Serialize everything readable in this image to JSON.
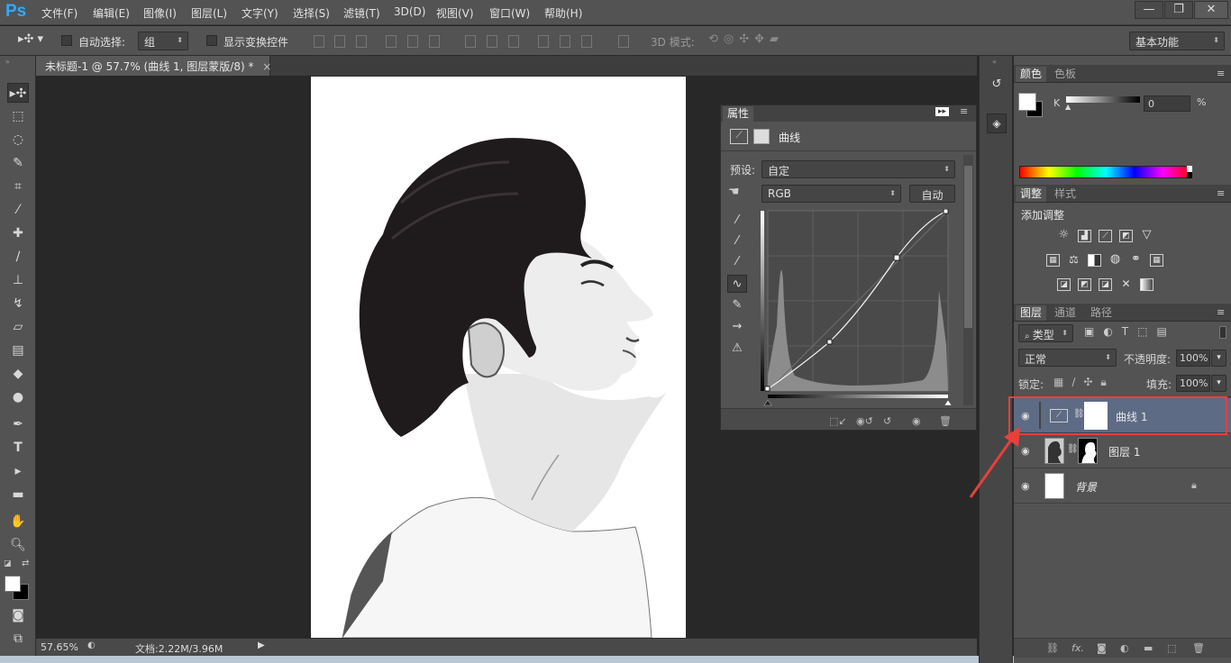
{
  "app": {
    "logo": "Ps"
  },
  "menu": [
    "文件(F)",
    "编辑(E)",
    "图像(I)",
    "图层(L)",
    "文字(Y)",
    "选择(S)",
    "滤镜(T)",
    "3D(D)",
    "视图(V)",
    "窗口(W)",
    "帮助(H)"
  ],
  "window_controls": {
    "minimize": "—",
    "restore": "❐",
    "close": "✕"
  },
  "options": {
    "auto_select_label": "自动选择:",
    "auto_select_value": "组",
    "show_transform_label": "显示变换控件",
    "mode_3d_label": "3D 模式:",
    "workspace": "基本功能"
  },
  "document_tab": {
    "title": "未标题-1 @ 57.7% (曲线 1, 图层蒙版/8) *",
    "close": "×"
  },
  "status": {
    "zoom": "57.65%",
    "doc_info": "文档:2.22M/3.96M"
  },
  "properties": {
    "tab": "属性",
    "title": "曲线",
    "preset_label": "预设:",
    "preset_value": "自定",
    "channel_value": "RGB",
    "auto_button": "自动"
  },
  "color_panel": {
    "tab_color": "颜色",
    "tab_swatches": "色板",
    "channel_label": "K",
    "value": "0",
    "unit": "%"
  },
  "adjustments_panel": {
    "tab_adjust": "调整",
    "tab_styles": "样式",
    "heading": "添加调整"
  },
  "layers_panel": {
    "tab_layers": "图层",
    "tab_channels": "通道",
    "tab_paths": "路径",
    "filter_kind": "类型",
    "blend_mode": "正常",
    "opacity_label": "不透明度:",
    "opacity_value": "100%",
    "lock_label": "锁定:",
    "fill_label": "填充:",
    "fill_value": "100%",
    "layers": [
      {
        "name": "曲线 1",
        "selected": true
      },
      {
        "name": "图层 1",
        "selected": false
      },
      {
        "name": "背景",
        "selected": false
      }
    ]
  },
  "colors": {
    "accent_highlight": "#e8403a",
    "panel_bg": "#535353",
    "selected_layer": "#5d6b84"
  }
}
